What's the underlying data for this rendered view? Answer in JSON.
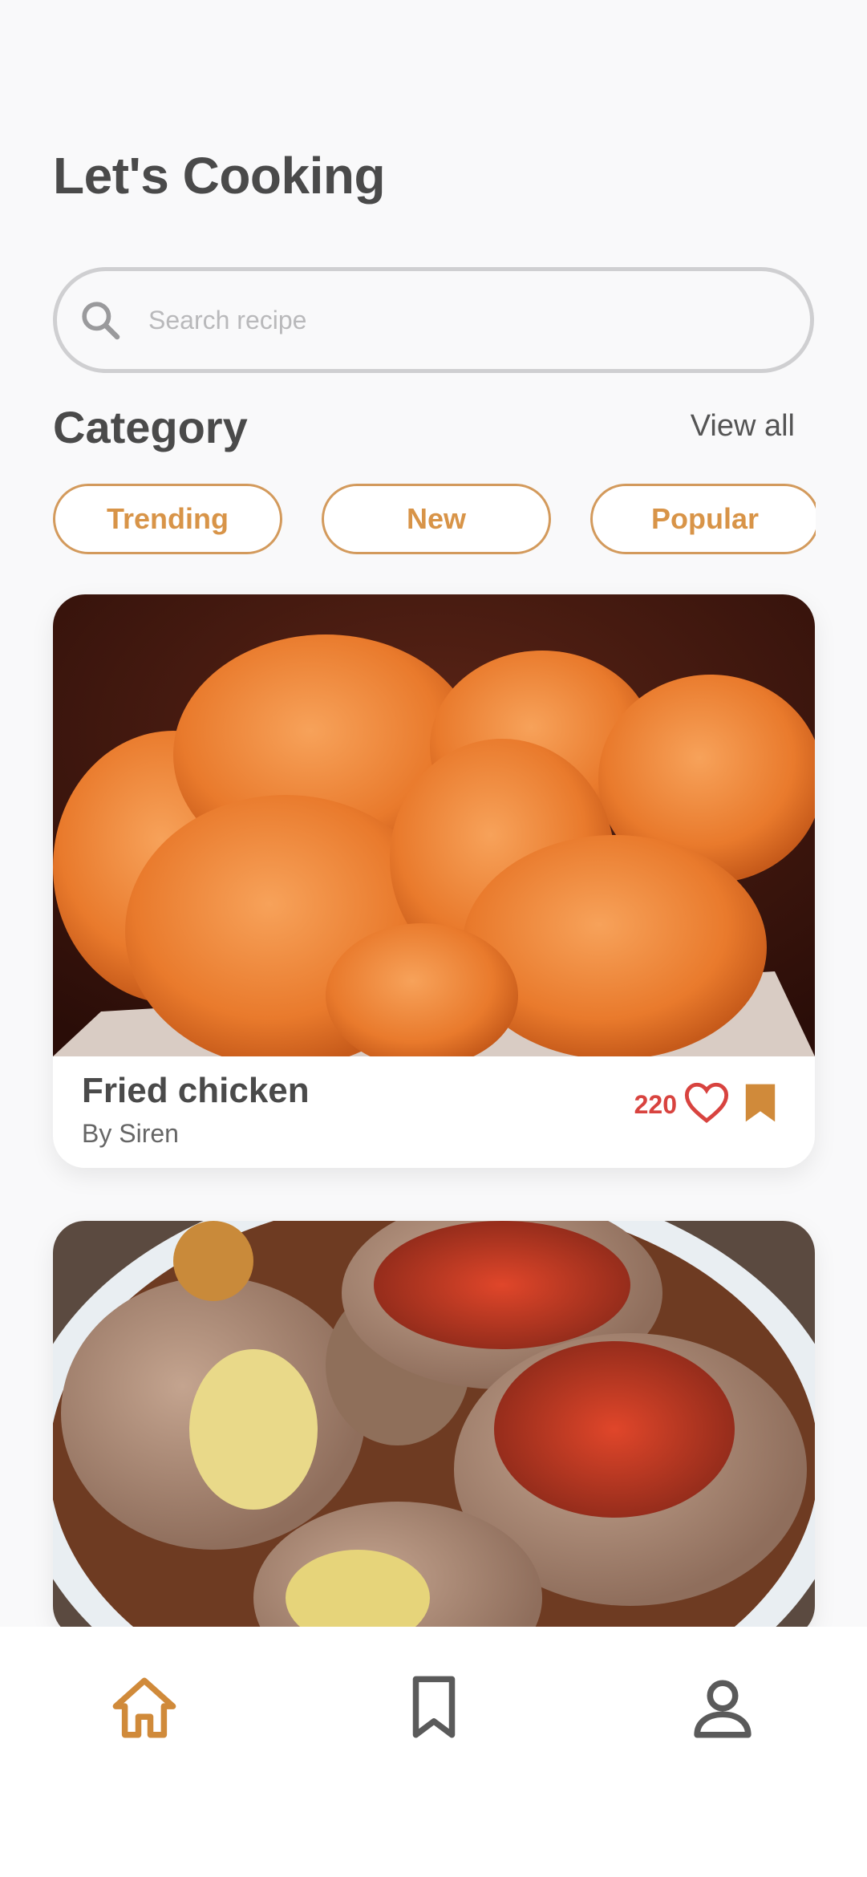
{
  "header": {
    "title": "Let's Cooking"
  },
  "search": {
    "placeholder": "Search recipe"
  },
  "category": {
    "title": "Category",
    "view_all": "View all",
    "chips": [
      {
        "label": "Trending"
      },
      {
        "label": "New"
      },
      {
        "label": "Popular"
      }
    ]
  },
  "recipes": [
    {
      "name": "Fried chicken",
      "author": "By Siren",
      "likes": "220"
    },
    {
      "name": "",
      "author": "",
      "likes": ""
    }
  ],
  "nav": {
    "items": [
      {
        "icon": "home-icon",
        "active": true
      },
      {
        "icon": "bookmark-icon",
        "active": false
      },
      {
        "icon": "profile-icon",
        "active": false
      }
    ]
  },
  "colors": {
    "accent": "#d89448",
    "like": "#d8433f",
    "bookmark": "#d08a3a",
    "inactive": "#5a5a5a"
  }
}
